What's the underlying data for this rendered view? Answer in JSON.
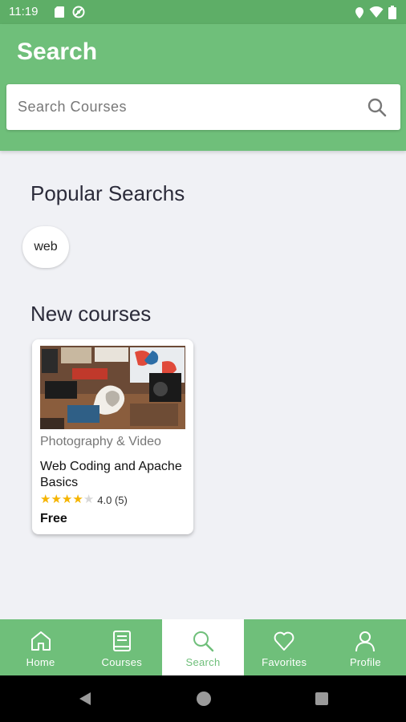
{
  "status_bar": {
    "time": "11:19",
    "left_icons": [
      "sd-card-icon",
      "no-data-icon"
    ],
    "right_icons": [
      "location-icon",
      "wifi-icon",
      "battery-icon"
    ]
  },
  "app_bar": {
    "title": "Search",
    "background_color": "#6fbf7a"
  },
  "search": {
    "placeholder": "Search Courses",
    "value": ""
  },
  "popular": {
    "title": "Popular Searchs",
    "chips": [
      "web"
    ]
  },
  "new_courses": {
    "title": "New courses",
    "items": [
      {
        "category": "Photography & Video",
        "title": "Web Coding and Apache Basics",
        "rating": 4.0,
        "rating_text": "4.0 (5)",
        "stars_filled": 4,
        "stars_total": 5,
        "price": "Free"
      }
    ]
  },
  "bottom_nav": {
    "items": [
      {
        "label": "Home",
        "icon": "home-icon",
        "active": false
      },
      {
        "label": "Courses",
        "icon": "book-icon",
        "active": false
      },
      {
        "label": "Search",
        "icon": "search-icon",
        "active": true
      },
      {
        "label": "Favorites",
        "icon": "heart-icon",
        "active": false
      },
      {
        "label": "Profile",
        "icon": "person-icon",
        "active": false
      }
    ]
  },
  "colors": {
    "primary_green": "#6fbf7a",
    "status_green": "#5eae67",
    "star": "#f5b400",
    "background": "#f0f1f5"
  }
}
